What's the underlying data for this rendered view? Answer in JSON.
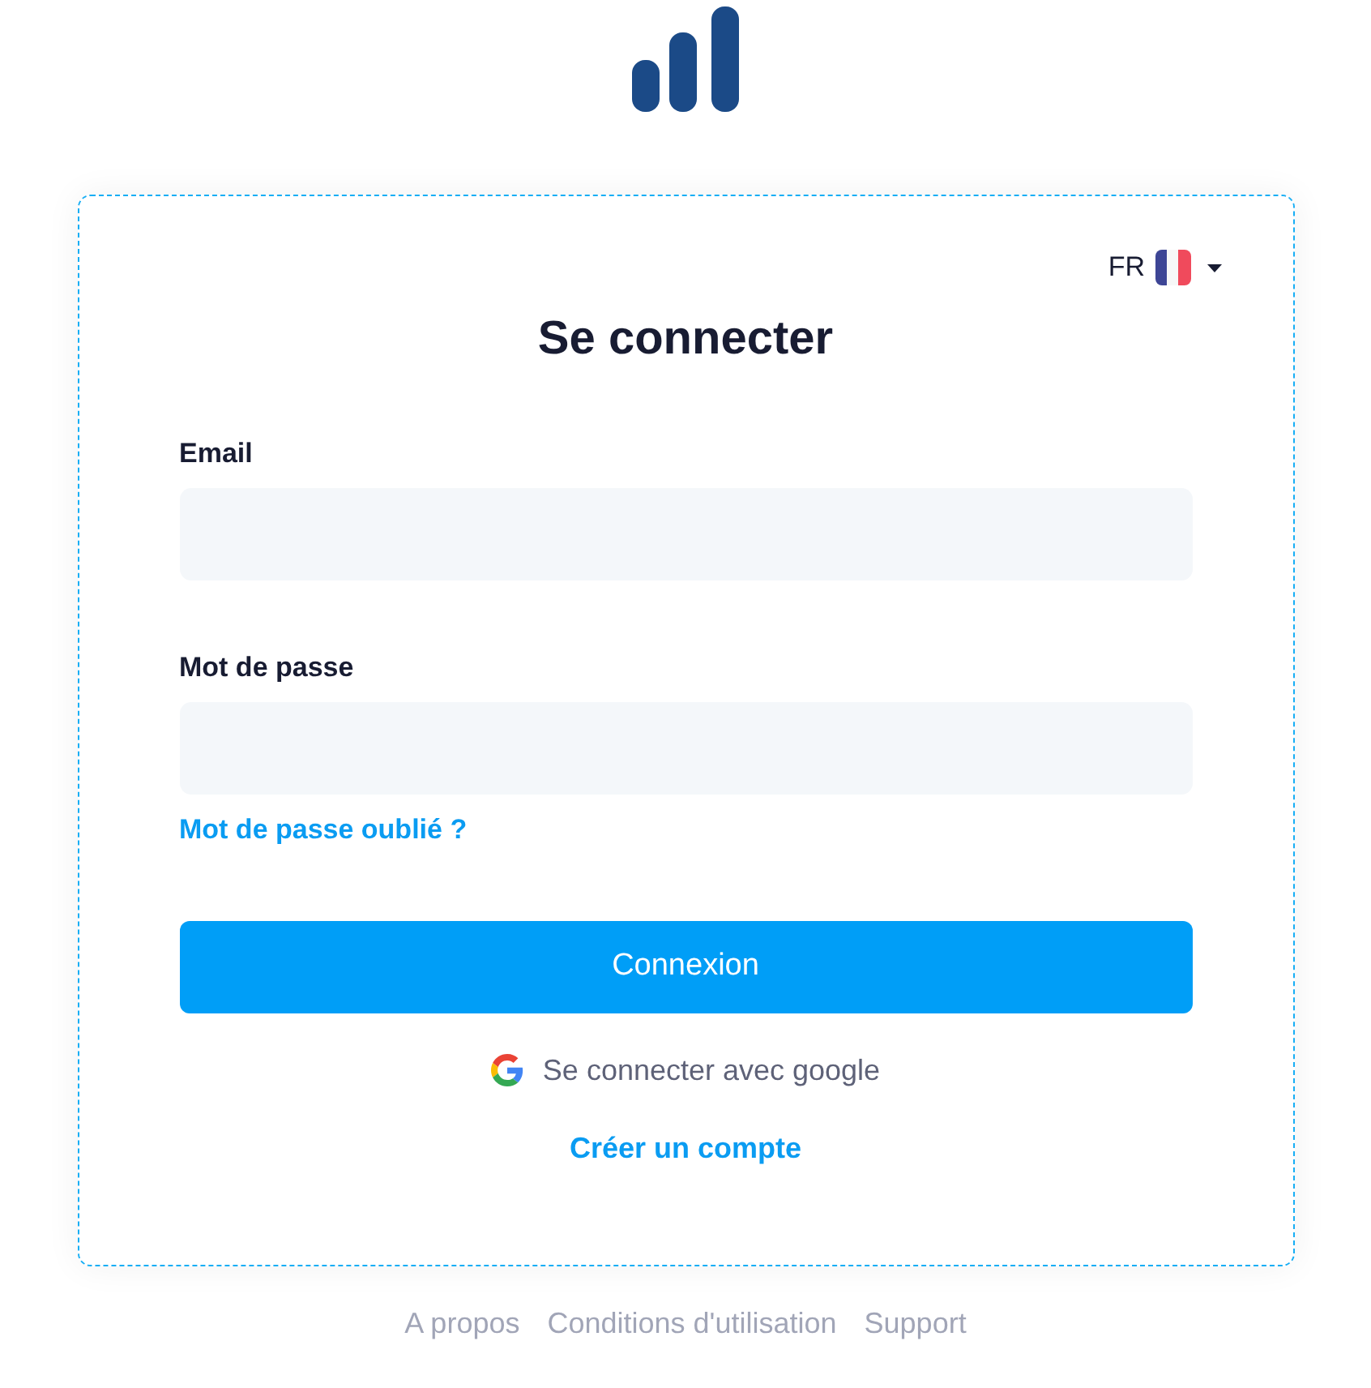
{
  "language_selector": {
    "code": "FR"
  },
  "title": "Se connecter",
  "fields": [
    {
      "label": "Email"
    },
    {
      "label": "Mot de passe"
    }
  ],
  "forgot_link": "Mot de passe oublié ?",
  "submit_button": "Connexion",
  "google_button": "Se connecter avec google",
  "signup_link": "Créer un compte",
  "footer_links": [
    "A propos",
    "Conditions d'utilisation",
    "Support"
  ]
}
